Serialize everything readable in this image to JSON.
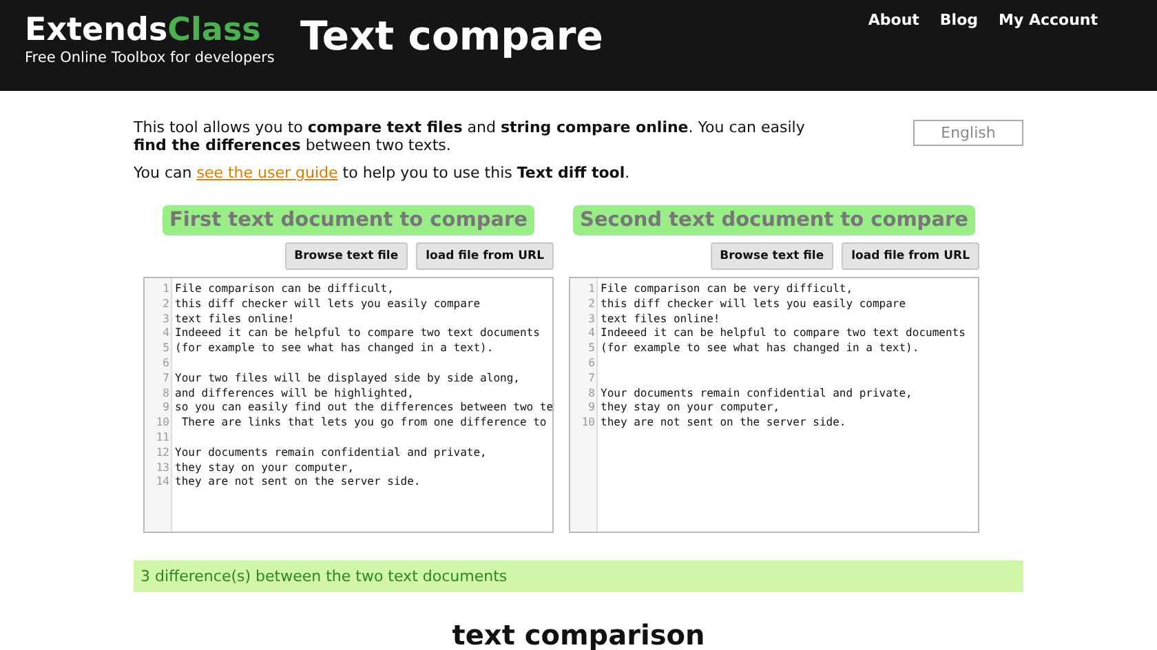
{
  "header": {
    "logo": {
      "part_1": "Extends",
      "part_2": "Class"
    },
    "tagline": "Free Online Toolbox for developers",
    "title": "Text compare",
    "nav": [
      "About",
      "Blog",
      "My Account"
    ]
  },
  "intro": {
    "paragraph": "This tool allows you to **compare text files** and **string compare online**. You can easily **find the differences** between two texts.",
    "guide": {
      "before": "You can ",
      "link": "see the user guide",
      "after": " to help you to use this **Text diff tool**."
    },
    "language": "English"
  },
  "documents": [
    {
      "heading": "First text document to compare",
      "buttons": [
        "Browse text file",
        "load file from URL"
      ],
      "lines": [
        {
          "number": "1",
          "text": "File comparison can be difficult,"
        },
        {
          "number": "2",
          "text": "this diff checker will lets you easily compare"
        },
        {
          "number": "3",
          "text": "text files online!"
        },
        {
          "number": "4",
          "text": "Indeeed it can be helpful to compare two text documents"
        },
        {
          "number": "5",
          "text": "(for example to see what has changed in a text)."
        },
        {
          "number": "6"
        },
        {
          "number": "7",
          "text": "Your two files will be displayed side by side along,"
        },
        {
          "number": "8",
          "text": "and differences will be highlighted,"
        },
        {
          "number": "9",
          "text": "so you can easily find out the differences between two te"
        },
        {
          "number": "10",
          "text": " There are links that lets you go from one difference to"
        },
        {
          "number": "11"
        },
        {
          "number": "12",
          "text": "Your documents remain confidential and private,"
        },
        {
          "number": "13",
          "text": "they stay on your computer,"
        },
        {
          "number": "14",
          "text": "they are not sent on the server side."
        }
      ]
    },
    {
      "heading": "Second text document to compare",
      "buttons": [
        "Browse text file",
        "load file from URL"
      ],
      "lines": [
        {
          "number": "1",
          "text": "File comparison can be very difficult,"
        },
        {
          "number": "2",
          "text": "this diff checker will lets you easily compare"
        },
        {
          "number": "3",
          "text": "text files online!"
        },
        {
          "number": "4",
          "text": "Indeeed it can be helpful to compare two text documents"
        },
        {
          "number": "5",
          "text": "(for example to see what has changed in a text)."
        },
        {
          "number": "6"
        },
        {
          "number": "7"
        },
        {
          "number": "8",
          "text": "Your documents remain confidential and private,"
        },
        {
          "number": "9",
          "text": "they stay on your computer,"
        },
        {
          "number": "10",
          "text": "they are not sent on the server side."
        }
      ]
    }
  ],
  "result": "3 difference(s) between the two text documents",
  "section_title": "text comparison"
}
